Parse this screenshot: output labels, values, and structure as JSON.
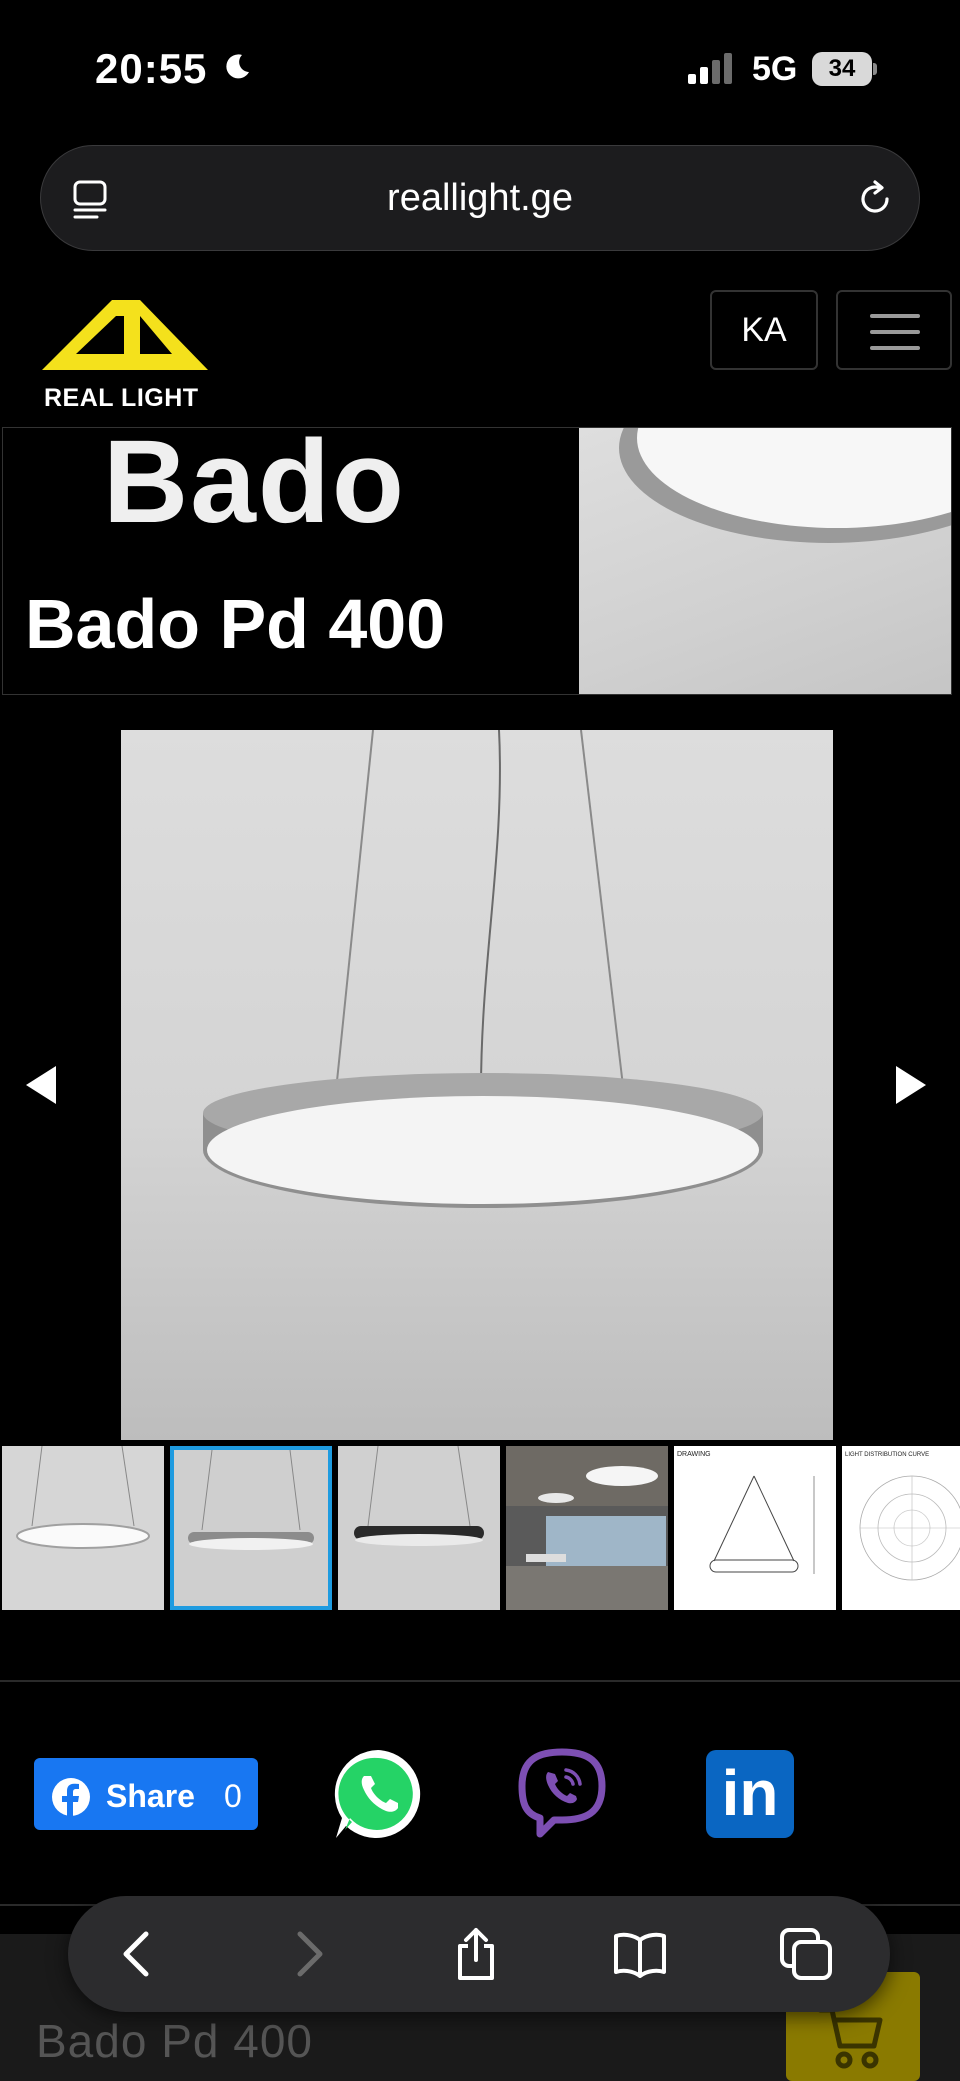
{
  "status_bar": {
    "time": "20:55",
    "network": "5G",
    "battery": "34",
    "icons": [
      "moon-icon",
      "signal-icon",
      "battery-icon"
    ]
  },
  "browser": {
    "url": "reallight.ge",
    "icons": [
      "tabs-page-icon",
      "reload-icon"
    ]
  },
  "site": {
    "logo_text": "REAL LIGHT",
    "logo_color": "#f4e11c",
    "language_label": "KA",
    "menu_icon": "hamburger-icon"
  },
  "hero": {
    "title": "Bado",
    "subtitle": "Bado Pd 400"
  },
  "gallery": {
    "prev_icon": "arrow-left-icon",
    "next_icon": "arrow-right-icon",
    "active_thumbnail": 2,
    "thumbnails": [
      "thumb-white-pendant",
      "thumb-grey-pendant",
      "thumb-black-pendant",
      "thumb-office-install",
      "thumb-drawing",
      "thumb-distribution-curve"
    ],
    "thumb_labels": {
      "drawing": "DRAWING",
      "curve": "LIGHT DISTRIBUTION CURVE"
    },
    "accent_color": "#1e9be0"
  },
  "share": {
    "facebook_label": "Share",
    "facebook_count": "0",
    "facebook_color": "#1877f2",
    "whatsapp_color": "#25d366",
    "viber_color": "#7d4fb3",
    "linkedin_color": "#0a66c2",
    "linkedin_label": "in"
  },
  "product_bar": {
    "title": "Bado Pd 400",
    "cart_icon": "cart-icon",
    "cart_color": "#f4e11c"
  },
  "safari_toolbar": {
    "icons": [
      "back-icon",
      "forward-icon",
      "share-icon",
      "bookmarks-icon",
      "tabs-icon"
    ]
  }
}
